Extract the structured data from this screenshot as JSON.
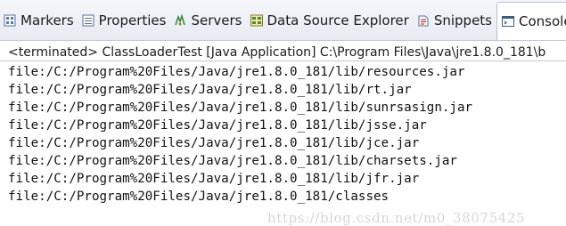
{
  "tabs": [
    {
      "label": "Markers",
      "icon": "markers-icon"
    },
    {
      "label": "Properties",
      "icon": "properties-icon"
    },
    {
      "label": "Servers",
      "icon": "servers-icon"
    },
    {
      "label": "Data Source Explorer",
      "icon": "data-source-explorer-icon"
    },
    {
      "label": "Snippets",
      "icon": "snippets-icon"
    },
    {
      "label": "Console",
      "icon": "console-icon"
    }
  ],
  "console": {
    "header": "<terminated> ClassLoaderTest [Java Application] C:\\Program Files\\Java\\jre1.8.0_181\\b",
    "lines": [
      "file:/C:/Program%20Files/Java/jre1.8.0_181/lib/resources.jar",
      "file:/C:/Program%20Files/Java/jre1.8.0_181/lib/rt.jar",
      "file:/C:/Program%20Files/Java/jre1.8.0_181/lib/sunrsasign.jar",
      "file:/C:/Program%20Files/Java/jre1.8.0_181/lib/jsse.jar",
      "file:/C:/Program%20Files/Java/jre1.8.0_181/lib/jce.jar",
      "file:/C:/Program%20Files/Java/jre1.8.0_181/lib/charsets.jar",
      "file:/C:/Program%20Files/Java/jre1.8.0_181/lib/jfr.jar",
      "file:/C:/Program%20Files/Java/jre1.8.0_181/classes"
    ]
  },
  "watermark": "https://blog.csdn.net/m0_38075425"
}
